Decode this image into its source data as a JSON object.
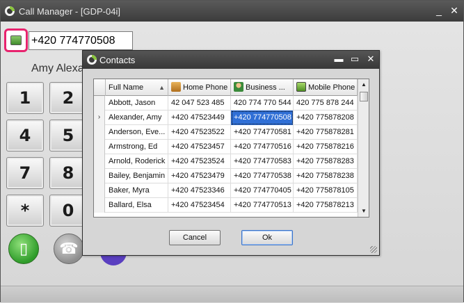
{
  "main_window": {
    "title": "Call Manager - [GDP-04i]",
    "minimize_glyph": "_",
    "close_glyph": "✕",
    "phone_number": "+420 774770508",
    "caller_name": "Amy Alexa",
    "keys": [
      "1",
      "2",
      "4",
      "5",
      "7",
      "8",
      "*",
      "0"
    ]
  },
  "dialog": {
    "title": "Contacts",
    "minimize_glyph": "▬",
    "maximize_glyph": "▭",
    "close_glyph": "✕",
    "columns": {
      "full_name": "Full Name",
      "home_phone": "Home Phone",
      "business_phone": "Business ...",
      "mobile_phone": "Mobile Phone"
    },
    "sort_glyph": "▲",
    "current_row_glyph": "›",
    "rows": [
      {
        "name": "Abbott, Jason",
        "home": "42 047 523 485",
        "business": "420 774 770 544",
        "mobile": "420 775 878 244"
      },
      {
        "name": "Alexander, Amy",
        "home": "+420 47523449",
        "business": "+420 774770508",
        "mobile": "+420 775878208"
      },
      {
        "name": "Anderson, Eve...",
        "home": "+420 47523522",
        "business": "+420 774770581",
        "mobile": "+420 775878281"
      },
      {
        "name": "Armstrong, Ed",
        "home": "+420 47523457",
        "business": "+420 774770516",
        "mobile": "+420 775878216"
      },
      {
        "name": "Arnold, Roderick",
        "home": "+420 47523524",
        "business": "+420 774770583",
        "mobile": "+420 775878283"
      },
      {
        "name": "Bailey, Benjamin",
        "home": "+420 47523479",
        "business": "+420 774770538",
        "mobile": "+420 775878238"
      },
      {
        "name": "Baker, Myra",
        "home": "+420 47523346",
        "business": "+420 774770405",
        "mobile": "+420 775878105"
      },
      {
        "name": "Ballard, Elsa",
        "home": "+420 47523454",
        "business": "+420 774770513",
        "mobile": "+420 775878213"
      }
    ],
    "cancel_label": "Cancel",
    "ok_label": "Ok"
  },
  "colors": {
    "accent_highlight": "#e8236e",
    "selection": "#2f6fd6",
    "titlebar": "#3c3c3c"
  },
  "icons": {
    "app": "app-logo-icon",
    "contacts": "contacts-book-icon",
    "home": "home-icon",
    "business": "business-person-icon",
    "mobile": "mobile-phone-icon",
    "call": "mobile-call-icon",
    "phone": "telephone-icon"
  }
}
